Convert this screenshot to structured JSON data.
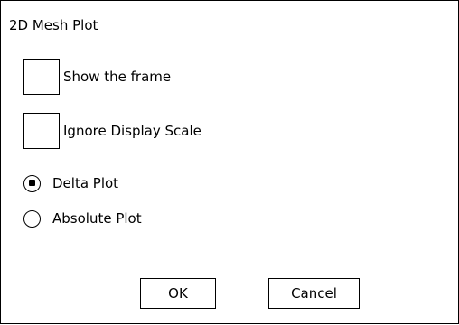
{
  "dialog": {
    "title": "2D Mesh Plot"
  },
  "options": {
    "show_frame": {
      "label": "Show the frame",
      "checked": false
    },
    "ignore_display_scale": {
      "label": "Ignore Display Scale",
      "checked": false
    }
  },
  "plot_mode": {
    "delta": {
      "label": "Delta Plot",
      "selected": true
    },
    "absolute": {
      "label": "Absolute Plot",
      "selected": false
    }
  },
  "buttons": {
    "ok_label": "OK",
    "cancel_label": "Cancel"
  }
}
